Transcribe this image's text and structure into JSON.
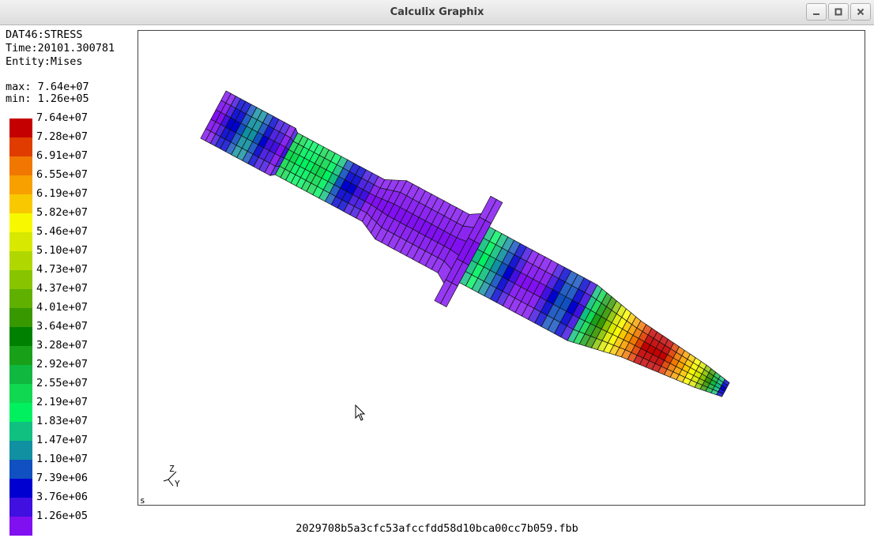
{
  "window": {
    "title": "Calculix Graphix"
  },
  "info": {
    "dataset": "DAT46:STRESS",
    "time": "Time:20101.300781",
    "entity": "Entity:Mises",
    "max": "max: 7.64e+07",
    "min": "min: 1.26e+05"
  },
  "legend": {
    "labels": [
      "7.64e+07",
      "7.28e+07",
      "6.91e+07",
      "6.55e+07",
      "6.19e+07",
      "5.82e+07",
      "5.46e+07",
      "5.10e+07",
      "4.73e+07",
      "4.37e+07",
      "4.01e+07",
      "3.64e+07",
      "3.28e+07",
      "2.92e+07",
      "2.55e+07",
      "2.19e+07",
      "1.83e+07",
      "1.47e+07",
      "1.10e+07",
      "7.39e+06",
      "3.76e+06",
      "1.26e+05"
    ],
    "colors": [
      "#c40000",
      "#e03c00",
      "#f07800",
      "#f8a000",
      "#f8c800",
      "#f8f800",
      "#d8e800",
      "#b0d800",
      "#88c400",
      "#60b000",
      "#389800",
      "#008000",
      "#18a018",
      "#10b840",
      "#10d850",
      "#00f060",
      "#10c080",
      "#1090a0",
      "#1050c0",
      "#0000d0",
      "#4010e0",
      "#8010f0"
    ]
  },
  "viewport": {
    "corner_label": "s",
    "axis_labels": {
      "z": "Z",
      "y": "Y"
    }
  },
  "footer": {
    "filename": "2029708b5a3cfc53afccfdd58d10bca00cc7b059.fbb"
  }
}
